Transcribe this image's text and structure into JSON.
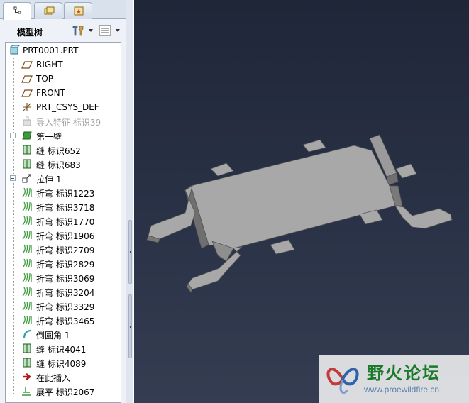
{
  "panel": {
    "title": "模型树",
    "tabs": [
      {
        "name": "model-tree-tab",
        "icon": "model-tree-icon",
        "active": true
      },
      {
        "name": "folder-browser-tab",
        "icon": "folders-icon",
        "active": false
      },
      {
        "name": "favorites-tab",
        "icon": "favorites-icon",
        "active": false
      }
    ],
    "buttons": [
      {
        "name": "settings-button",
        "icon": "tools-icon"
      },
      {
        "name": "show-button",
        "icon": "list-icon"
      }
    ]
  },
  "tree": [
    {
      "label": "PRT0001.PRT",
      "icon": "part-icon"
    },
    {
      "label": "RIGHT",
      "icon": "datum-plane-icon"
    },
    {
      "label": "TOP",
      "icon": "datum-plane-icon"
    },
    {
      "label": "FRONT",
      "icon": "datum-plane-icon"
    },
    {
      "label": "PRT_CSYS_DEF",
      "icon": "csys-icon"
    },
    {
      "label": "导入特征 标识39",
      "icon": "import-feature-icon",
      "suppressed": true
    },
    {
      "label": "第一壁",
      "icon": "first-wall-icon",
      "expandable": true
    },
    {
      "label": "缝 标识652",
      "icon": "rip-icon"
    },
    {
      "label": "缝 标识683",
      "icon": "rip-icon"
    },
    {
      "label": "拉伸 1",
      "icon": "extrude-icon",
      "expandable": true
    },
    {
      "label": "折弯 标识1223",
      "icon": "bend-icon"
    },
    {
      "label": "折弯 标识3718",
      "icon": "bend-icon"
    },
    {
      "label": "折弯 标识1770",
      "icon": "bend-icon"
    },
    {
      "label": "折弯 标识1906",
      "icon": "bend-icon"
    },
    {
      "label": "折弯 标识2709",
      "icon": "bend-icon"
    },
    {
      "label": "折弯 标识2829",
      "icon": "bend-icon"
    },
    {
      "label": "折弯 标识3069",
      "icon": "bend-icon"
    },
    {
      "label": "折弯 标识3204",
      "icon": "bend-icon"
    },
    {
      "label": "折弯 标识3329",
      "icon": "bend-icon"
    },
    {
      "label": "折弯 标识3465",
      "icon": "bend-icon"
    },
    {
      "label": "倒圆角 1",
      "icon": "round-icon"
    },
    {
      "label": "缝 标识4041",
      "icon": "rip-icon"
    },
    {
      "label": "缝 标识4089",
      "icon": "rip-icon"
    },
    {
      "label": "在此插入",
      "icon": "insert-here-arrow-icon"
    },
    {
      "label": "展平 标识2067",
      "icon": "unbend-icon"
    }
  ],
  "watermark": {
    "title": "野火论坛",
    "url": "www.proewildfire.cn"
  },
  "colors": {
    "viewport_bg": "#262e42",
    "model_face": "#a8a8a8",
    "model_side": "#6f6f6f",
    "tree_icon_green": "#3c9a3c"
  }
}
